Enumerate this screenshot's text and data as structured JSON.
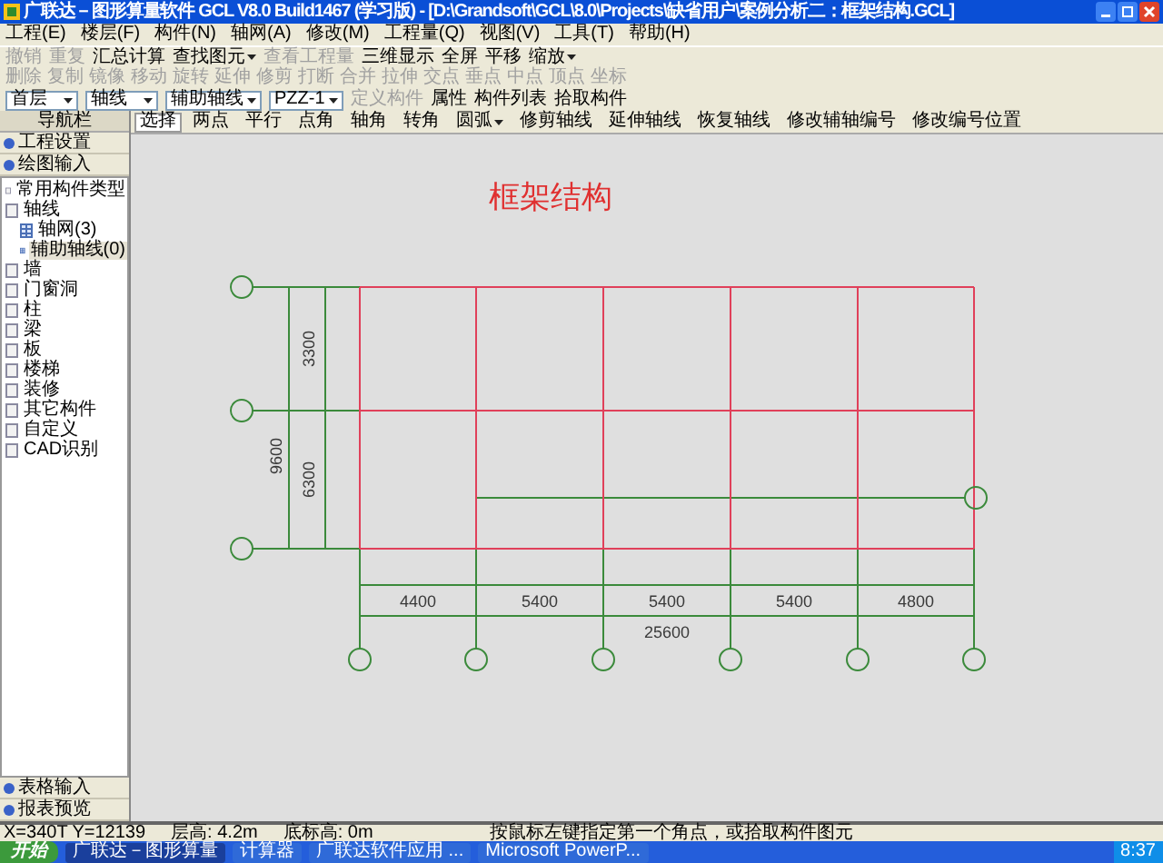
{
  "window": {
    "title": "广联达－图形算量软件 GCL V8.0 Build1467 (学习版) - [D:\\Grandsoft\\GCL\\8.0\\Projects\\缺省用户\\案例分析二：框架结构.GCL]"
  },
  "menu": [
    "工程(E)",
    "楼层(F)",
    "构件(N)",
    "轴网(A)",
    "修改(M)",
    "工程量(Q)",
    "视图(V)",
    "工具(T)",
    "帮助(H)"
  ],
  "toolbar_1": [
    {
      "label": "撤销",
      "disabled": true,
      "dropdown": false
    },
    {
      "label": "重复",
      "disabled": true,
      "dropdown": false
    },
    {
      "label": "汇总计算",
      "disabled": false,
      "dropdown": false
    },
    {
      "label": "查找图元",
      "disabled": false,
      "dropdown": true
    },
    {
      "label": "查看工程量",
      "disabled": true,
      "dropdown": false
    },
    {
      "label": "三维显示",
      "disabled": false,
      "dropdown": false
    },
    {
      "label": "全屏",
      "disabled": false,
      "dropdown": false
    },
    {
      "label": "平移",
      "disabled": false,
      "dropdown": false
    },
    {
      "label": "缩放",
      "disabled": false,
      "dropdown": true
    }
  ],
  "toolbar_2": [
    {
      "label": "删除",
      "disabled": true
    },
    {
      "label": "复制",
      "disabled": true
    },
    {
      "label": "镜像",
      "disabled": true
    },
    {
      "label": "移动",
      "disabled": true
    },
    {
      "label": "旋转",
      "disabled": true
    },
    {
      "label": "延伸",
      "disabled": true
    },
    {
      "label": "修剪",
      "disabled": true
    },
    {
      "label": "打断",
      "disabled": true
    },
    {
      "label": "合并",
      "disabled": true
    },
    {
      "label": "拉伸",
      "disabled": true
    },
    {
      "label": "交点",
      "disabled": true
    },
    {
      "label": "垂点",
      "disabled": true
    },
    {
      "label": "中点",
      "disabled": true
    },
    {
      "label": "顶点",
      "disabled": true
    },
    {
      "label": "坐标",
      "disabled": true
    }
  ],
  "toolbar_3": [
    {
      "kind": "select",
      "value": "首层"
    },
    {
      "kind": "select",
      "value": "轴线"
    },
    {
      "kind": "select",
      "value": "辅助轴线"
    },
    {
      "kind": "select",
      "value": "PZZ-1"
    },
    {
      "kind": "button",
      "label": "定义构件",
      "disabled": true
    },
    {
      "kind": "button",
      "label": "属性",
      "disabled": false
    },
    {
      "kind": "button",
      "label": "构件列表",
      "disabled": false
    },
    {
      "kind": "button",
      "label": "拾取构件",
      "disabled": false
    }
  ],
  "navigator": {
    "title": "导航栏",
    "sections_top": [
      "工程设置",
      "绘图输入"
    ],
    "tree": [
      {
        "label": "常用构件类型",
        "selected": false
      },
      {
        "label": "轴线",
        "selected": false,
        "children": [
          {
            "label": "轴网(3)",
            "selected": false
          },
          {
            "label": "辅助轴线(0)",
            "selected": true
          }
        ]
      },
      {
        "label": "墙",
        "selected": false
      },
      {
        "label": "门窗洞",
        "selected": false
      },
      {
        "label": "柱",
        "selected": false
      },
      {
        "label": "梁",
        "selected": false
      },
      {
        "label": "板",
        "selected": false
      },
      {
        "label": "楼梯",
        "selected": false
      },
      {
        "label": "装修",
        "selected": false
      },
      {
        "label": "其它构件",
        "selected": false
      },
      {
        "label": "自定义",
        "selected": false
      },
      {
        "label": "CAD识别",
        "selected": false
      }
    ],
    "sections_bottom": [
      "表格输入",
      "报表预览"
    ]
  },
  "drawing_toolbar": [
    {
      "label": "选择",
      "selected": true,
      "dropdown": false
    },
    {
      "label": "两点",
      "selected": false,
      "dropdown": false
    },
    {
      "label": "平行",
      "selected": false,
      "dropdown": false
    },
    {
      "label": "点角",
      "selected": false,
      "dropdown": false
    },
    {
      "label": "轴角",
      "selected": false,
      "dropdown": false
    },
    {
      "label": "转角",
      "selected": false,
      "dropdown": false
    },
    {
      "label": "圆弧",
      "selected": false,
      "dropdown": true
    },
    {
      "label": "修剪轴线",
      "selected": false,
      "dropdown": false
    },
    {
      "label": "延伸轴线",
      "selected": false,
      "dropdown": false
    },
    {
      "label": "恢复轴线",
      "selected": false,
      "dropdown": false
    },
    {
      "label": "修改辅轴编号",
      "selected": false,
      "dropdown": false
    },
    {
      "label": "修改编号位置",
      "selected": false,
      "dropdown": false
    }
  ],
  "canvas": {
    "heading": "框架结构",
    "horizontal_dimensions": [
      "4400",
      "5400",
      "5400",
      "5400",
      "4800"
    ],
    "horizontal_total": "25600",
    "vertical_dimensions": [
      "3300",
      "6300"
    ],
    "vertical_total": "9600"
  },
  "status_bar": {
    "coordinates": "X=340T Y=12139",
    "floor_height": "层高: 4.2m",
    "base_elevation": "底标高: 0m",
    "prompt": "按鼠标左键指定第一个角点，或拾取构件图元"
  },
  "taskbar": {
    "start": "开始",
    "tasks": [
      {
        "label": "广联达－图形算量",
        "active": true
      },
      {
        "label": "计算器",
        "active": false
      },
      {
        "label": "广联达软件应用 ...",
        "active": false
      },
      {
        "label": "Microsoft PowerP...",
        "active": false
      }
    ],
    "clock": "8:37"
  }
}
